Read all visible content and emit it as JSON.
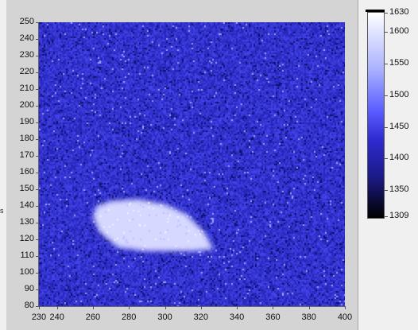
{
  "side_label": "s",
  "intensity_graph": {
    "x_axis": {
      "range": [
        230,
        400
      ],
      "ticks": [
        "230",
        "240",
        "260",
        "280",
        "300",
        "320",
        "340",
        "360",
        "380",
        "400"
      ]
    },
    "y_axis": {
      "range": [
        80,
        250
      ],
      "ticks": [
        "80",
        "90",
        "100",
        "110",
        "120",
        "130",
        "140",
        "150",
        "160",
        "170",
        "180",
        "190",
        "200",
        "210",
        "220",
        "230",
        "240",
        "250"
      ]
    },
    "colors": {
      "background": "#2c2ec8",
      "blob": "#dcdcff"
    },
    "blob_vertices_data_units": [
      [
        262,
        140
      ],
      [
        270,
        143
      ],
      [
        285,
        144
      ],
      [
        300,
        141
      ],
      [
        312,
        135
      ],
      [
        322,
        124
      ],
      [
        327,
        114
      ],
      [
        315,
        113
      ],
      [
        290,
        113
      ],
      [
        274,
        115
      ],
      [
        264,
        124
      ],
      [
        260,
        133
      ]
    ]
  },
  "color_scale": {
    "range": [
      1309,
      1630
    ],
    "tick_labels": [
      "1630",
      "1600",
      "1550",
      "1500",
      "1450",
      "1400",
      "1350",
      "1309"
    ],
    "tick_values": [
      1630,
      1600,
      1550,
      1500,
      1450,
      1400,
      1350,
      1309
    ]
  }
}
